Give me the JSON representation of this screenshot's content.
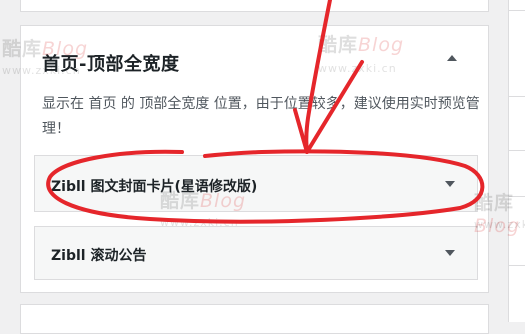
{
  "section": {
    "title": "首页-顶部全宽度",
    "description": "显示在 首页 的 顶部全宽度 位置，由于位置较多，建议使用实时预览管理！"
  },
  "widgets": [
    {
      "label": "Zibll 图文封面卡片(星语修改版)"
    },
    {
      "label": "Zibll 滚动公告"
    }
  ],
  "watermark": {
    "logo_cn": "酷库",
    "logo_en": "Blog",
    "url": "www.zxki.cn"
  },
  "icons": {
    "collapse": "chevron-up-icon",
    "expand": "chevron-down-icon"
  },
  "colors": {
    "annotation": "#e5262b",
    "background": "#f0f0f1",
    "panel": "#ffffff",
    "widget": "#f6f7f7"
  }
}
